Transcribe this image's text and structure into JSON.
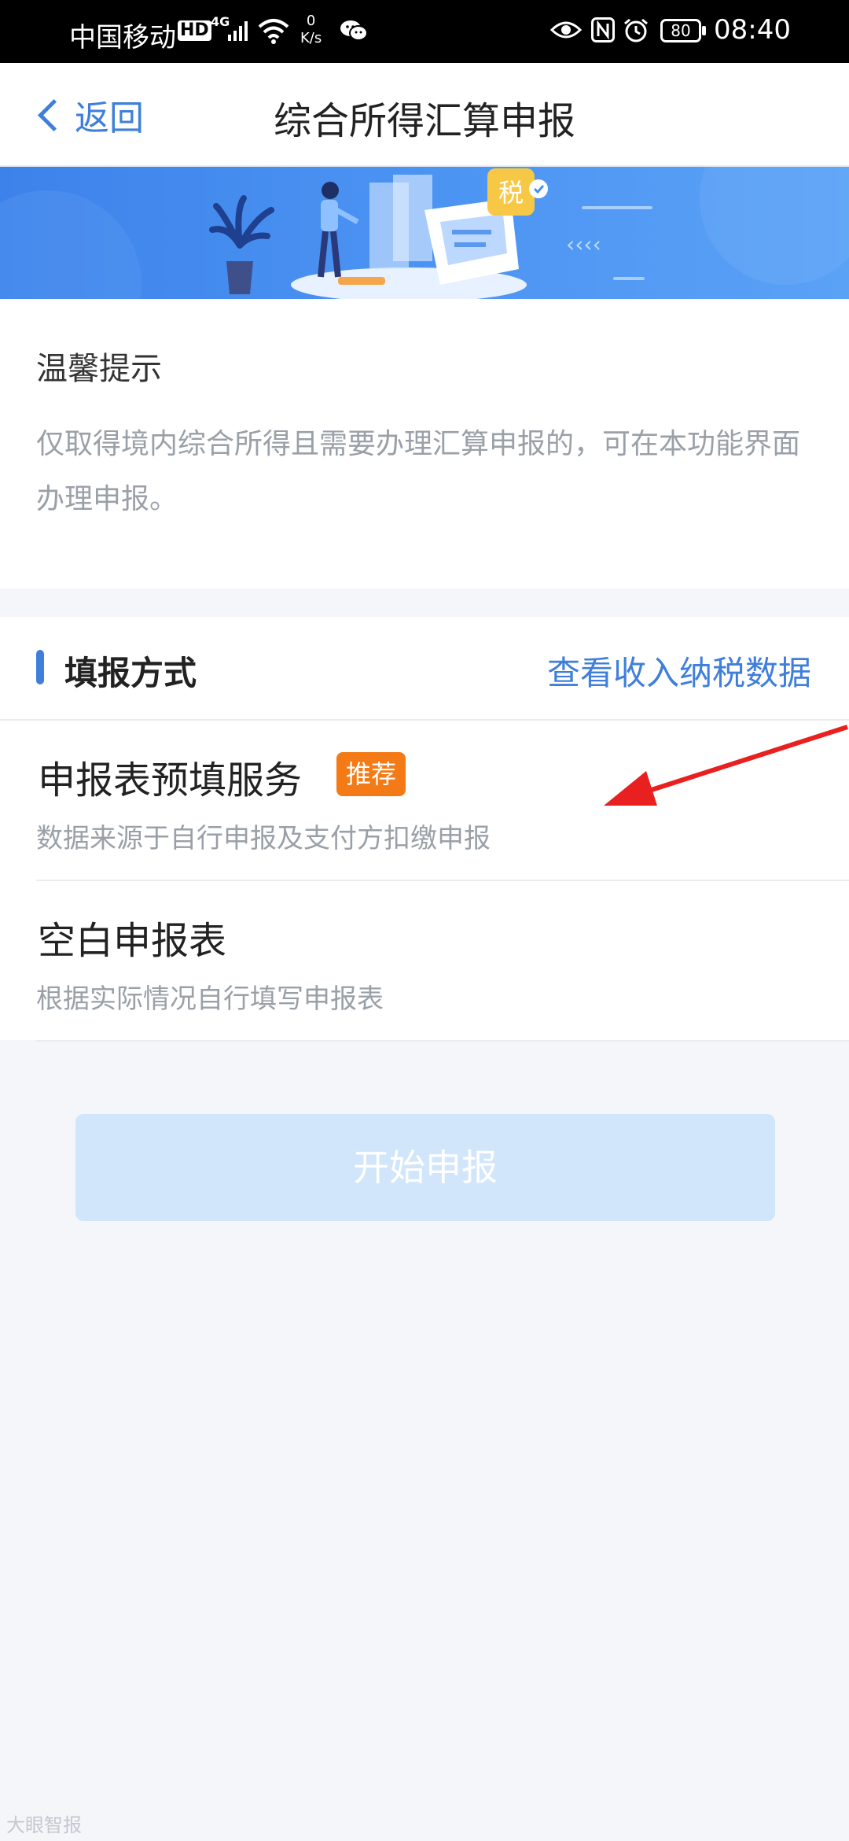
{
  "status_bar": {
    "carrier": "中国移动",
    "hd": "HD",
    "network": "4G",
    "speed_value": "0",
    "speed_unit": "K/s",
    "battery": "80",
    "time": "08:40"
  },
  "header": {
    "back_label": "返回",
    "title": "综合所得汇算申报"
  },
  "banner": {
    "tax_char": "税"
  },
  "tips": {
    "title": "温馨提示",
    "body": "仅取得境内综合所得且需要办理汇算申报的，可在本功能界面办理申报。"
  },
  "methods": {
    "title": "填报方式",
    "link": "查看收入纳税数据",
    "options": [
      {
        "title": "申报表预填服务",
        "badge": "推荐",
        "description": "数据来源于自行申报及支付方扣缴申报"
      },
      {
        "title": "空白申报表",
        "description": "根据实际情况自行填写申报表"
      }
    ]
  },
  "start_button": "开始申报",
  "watermark": "大眼智报",
  "colors": {
    "accent": "#3f7fdb",
    "badge": "#f47a16",
    "button_disabled": "#d2e6fb",
    "annotation_arrow": "#e8201f"
  }
}
